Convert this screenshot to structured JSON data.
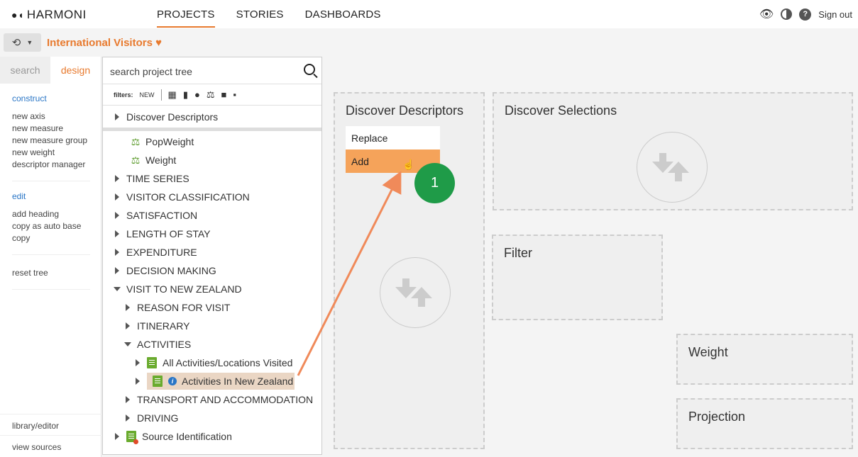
{
  "app": {
    "brand": "HARMONI"
  },
  "nav": {
    "projects": "PROJECTS",
    "stories": "STORIES",
    "dashboards": "DASHBOARDS"
  },
  "top_right": {
    "sign_out": "Sign out",
    "help": "?"
  },
  "project": {
    "title": "International Visitors",
    "heart": "♥"
  },
  "left_panel": {
    "tabs": {
      "search": "search",
      "design": "design"
    },
    "construct": {
      "heading": "construct",
      "items": [
        "new axis",
        "new measure",
        "new measure group",
        "new weight",
        "descriptor manager"
      ]
    },
    "edit": {
      "heading": "edit",
      "items": [
        "add heading",
        "copy as auto base",
        "copy"
      ]
    },
    "reset": "reset tree",
    "library_editor": "library/editor",
    "view_sources": "view sources"
  },
  "tree": {
    "search_placeholder": "search project tree",
    "filters_label": "filters:",
    "filters_new": "NEW",
    "discover_descriptors": "Discover Descriptors",
    "popweight": "PopWeight",
    "weight": "Weight",
    "time_series": "TIME SERIES",
    "visitor_classification": "VISITOR CLASSIFICATION",
    "satisfaction": "SATISFACTION",
    "length_of_stay": "LENGTH OF STAY",
    "expenditure": "EXPENDITURE",
    "decision_making": "DECISION MAKING",
    "visit_to_nz": "VISIT TO NEW ZEALAND",
    "reason_for_visit": "REASON FOR VISIT",
    "itinerary": "ITINERARY",
    "activities": "ACTIVITIES",
    "all_activities": "All Activities/Locations Visited",
    "activities_nz": "Activities In New Zealand",
    "transport": "TRANSPORT AND ACCOMMODATION",
    "driving": "DRIVING",
    "source_identification": "Source Identification"
  },
  "canvas": {
    "discover_descriptors": "Discover Descriptors",
    "discover_selections": "Discover Selections",
    "filter": "Filter",
    "weight": "Weight",
    "projection": "Projection",
    "menu_replace": "Replace",
    "menu_add": "Add",
    "step_number": "1"
  },
  "colors": {
    "accent": "#e87a2e",
    "badge": "#1f9b48",
    "menu_add": "#f5a35a",
    "link": "#2a76c6"
  }
}
